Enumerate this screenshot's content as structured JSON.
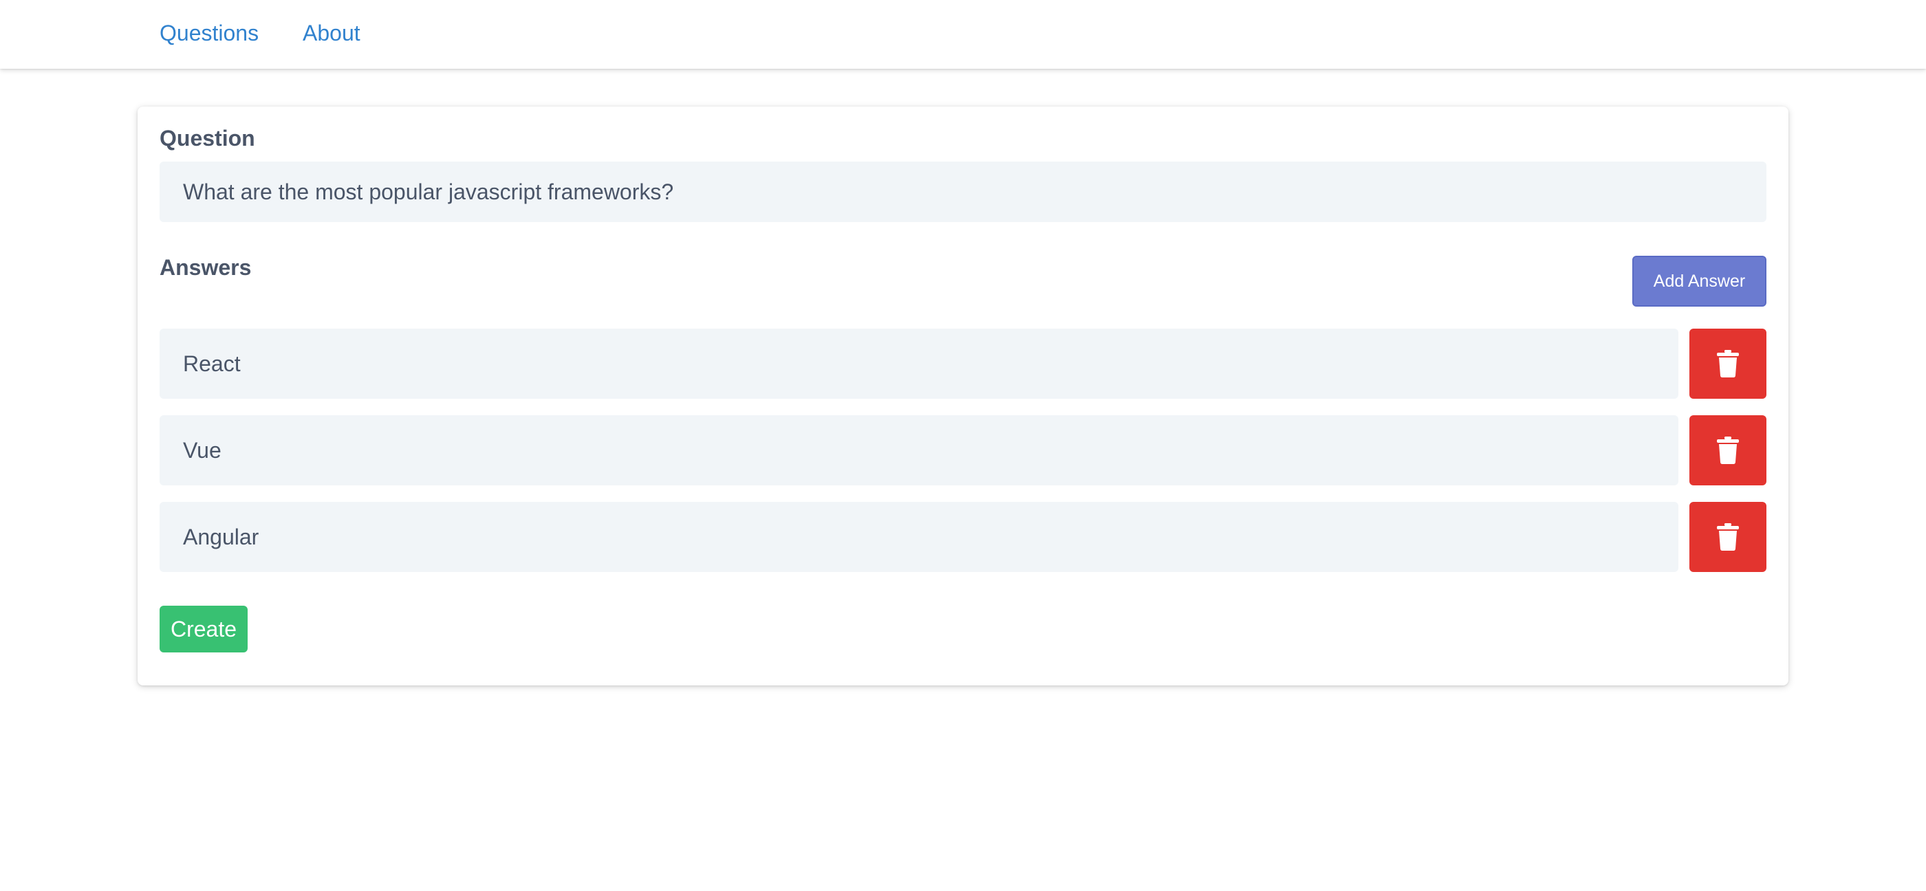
{
  "nav": {
    "links": [
      {
        "label": "Questions"
      },
      {
        "label": "About"
      }
    ]
  },
  "form": {
    "question_label": "Question",
    "question_value": "What are the most popular javascript frameworks?",
    "answers_label": "Answers",
    "add_answer_label": "Add Answer",
    "answers": [
      {
        "value": "React"
      },
      {
        "value": "Vue"
      },
      {
        "value": "Angular"
      }
    ],
    "delete_icon": "trash-icon",
    "create_label": "Create"
  },
  "colors": {
    "link": "#3182ce",
    "add_button": "#6b7bd0",
    "delete_button": "#e3342f",
    "create_button": "#38c172",
    "field_background": "#f1f5f8"
  }
}
